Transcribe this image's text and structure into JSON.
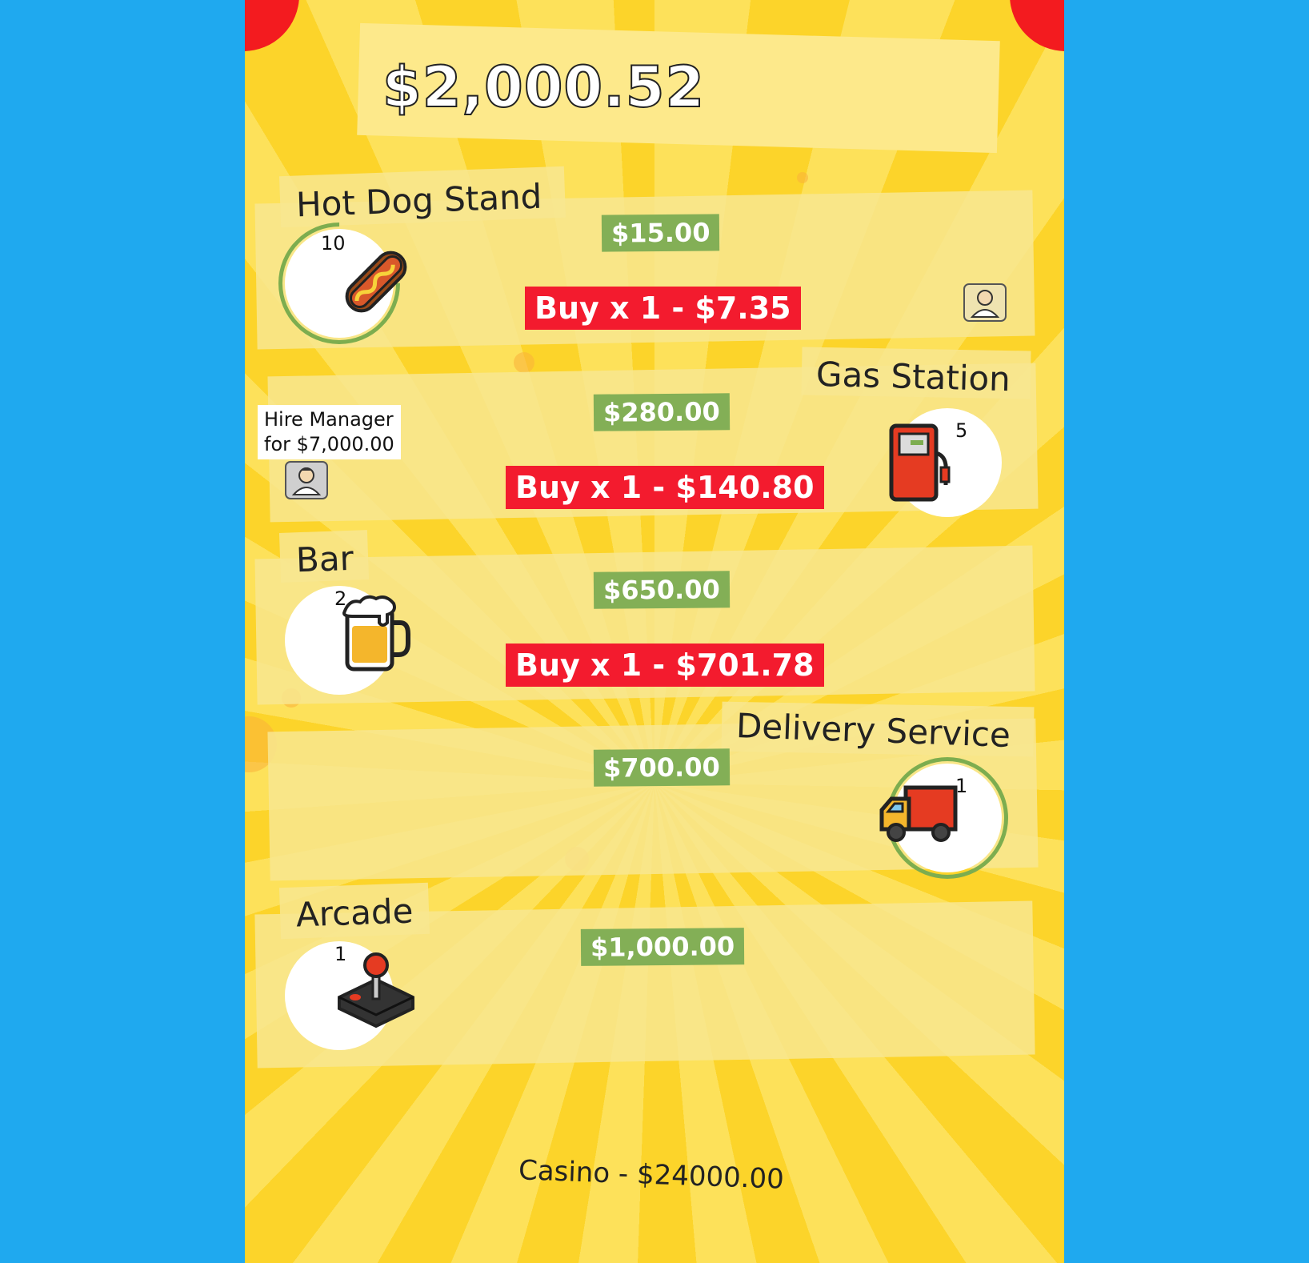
{
  "money": "$2,000.52",
  "businesses": [
    {
      "name": "Hot Dog Stand",
      "count": "10",
      "earnings": "$15.00",
      "buy": "Buy x 1 - $7.35",
      "icon": "hot-dog-icon",
      "manager": "hired",
      "progress": 0.7
    },
    {
      "name": "Gas Station",
      "count": "5",
      "earnings": "$280.00",
      "buy": "Buy x 1 - $140.80",
      "icon": "gas-pump-icon",
      "manager_tooltip": "Hire Manager\nfor $7,000.00"
    },
    {
      "name": "Bar",
      "count": "2",
      "earnings": "$650.00",
      "buy": "Buy x 1 - $701.78",
      "icon": "beer-mug-icon"
    },
    {
      "name": "Delivery Service",
      "count": "1",
      "earnings": "$700.00",
      "icon": "delivery-truck-icon",
      "progress": 0.95
    },
    {
      "name": "Arcade",
      "count": "1",
      "earnings": "$1,000.00",
      "icon": "joystick-icon"
    }
  ],
  "casino": "Casino - $24000.00",
  "colors": {
    "background": "#1fa9ef",
    "earnings": "#83af56",
    "buy": "#f31b2e",
    "corner": "#f31b1f"
  }
}
